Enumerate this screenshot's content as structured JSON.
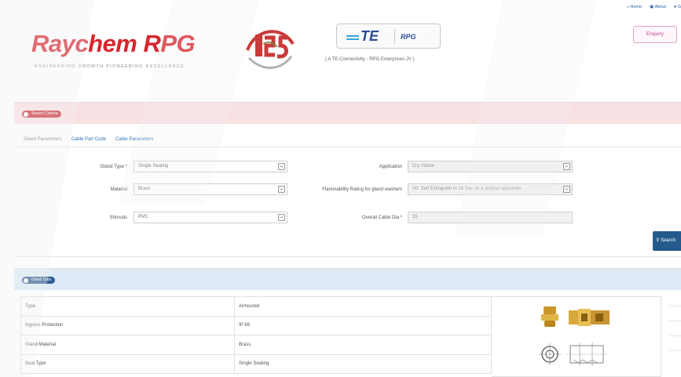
{
  "header": {
    "logo_text": "Raychem RPG",
    "tagline": "ENGINEERING GROWTH    PIONEERING EXCELLENCE",
    "jv_caption": "( A TE-Connectivity - RPG Enterprises JV )",
    "te_label": "TE",
    "rpg_label": "RPG",
    "top_links": [
      "Home",
      "About",
      "G"
    ],
    "enquiry_label": "Enquiry"
  },
  "search": {
    "title": "Search Criteria",
    "tabs": [
      "Gland Parameters",
      "Cable Part Code",
      "Cable Parameters"
    ],
    "fields": {
      "gland_type": {
        "label": "Gland Type *",
        "value": "Single Sealing"
      },
      "material": {
        "label": "Material",
        "value": "Brass"
      },
      "shrouds": {
        "label": "Shrouds",
        "value": "PVC"
      },
      "application": {
        "label": "Application",
        "value": "Dry Indoor"
      },
      "flammability": {
        "label": "Flammability Rating for gland washers",
        "value": "V0: Self Extinguish in 10 Sec on a vertical specimen"
      },
      "overall_dia": {
        "label": "Overall Cable Dia *",
        "value": "55"
      }
    },
    "button_label": "Search"
  },
  "gland_data": {
    "title": "Gland Data",
    "rows": [
      {
        "name": "Type",
        "value": "Armoured"
      },
      {
        "name": "Ingress Protection",
        "value": "IP 66"
      },
      {
        "name": "Gland Material",
        "value": "Brass"
      },
      {
        "name": "Seal Type",
        "value": "Single Sealing"
      }
    ]
  },
  "colors": {
    "brand_red": "#d8262f",
    "search_bar": "#f9e0e3",
    "data_bar": "#deebf6",
    "button": "#245a8c"
  }
}
